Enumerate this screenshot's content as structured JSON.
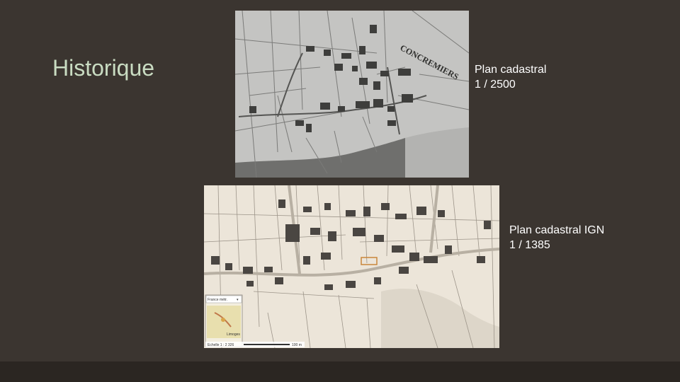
{
  "slide": {
    "title": "Historique",
    "background": "#3b3530",
    "title_color": "#c9dcc2"
  },
  "map_old": {
    "label_village": "CONCREMIERS",
    "caption_line1": "Plan cadastral",
    "caption_line2": "1 / 2500"
  },
  "map_ign": {
    "caption_line1": "Plan cadastral IGN",
    "caption_line2": "1 / 1385",
    "overlay_dropdown": "France métr.",
    "overlay_place": "Limoges",
    "scale_text": "Echelle 1 : 2 326",
    "scale_bar_text": "100 m"
  }
}
